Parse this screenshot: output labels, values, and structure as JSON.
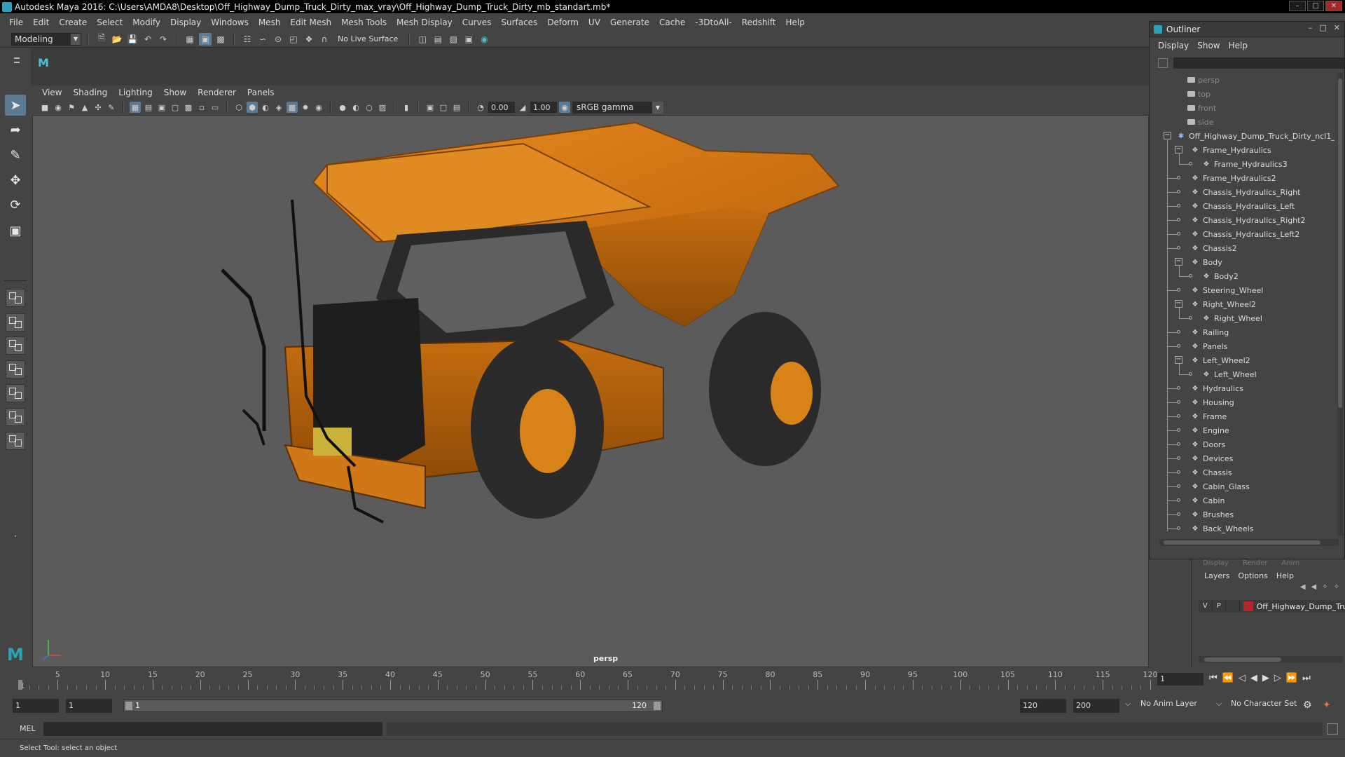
{
  "window": {
    "title": "Autodesk Maya 2016: C:\\Users\\AMDA8\\Desktop\\Off_Highway_Dump_Truck_Dirty_max_vray\\Off_Highway_Dump_Truck_Dirty_mb_standart.mb*"
  },
  "menubar": [
    "File",
    "Edit",
    "Create",
    "Select",
    "Modify",
    "Display",
    "Windows",
    "Mesh",
    "Edit Mesh",
    "Mesh Tools",
    "Mesh Display",
    "Curves",
    "Surfaces",
    "Deform",
    "UV",
    "Generate",
    "Cache",
    "-3DtoAll-",
    "Redshift",
    "Help"
  ],
  "statusline": {
    "mode": "Modeling",
    "live_surface": "No Live Surface"
  },
  "panel": {
    "menus": [
      "View",
      "Shading",
      "Lighting",
      "Show",
      "Renderer",
      "Panels"
    ],
    "exposure": "0.00",
    "gamma": "1.00",
    "color_space": "sRGB gamma",
    "camera": "persp"
  },
  "outliner": {
    "title": "Outliner",
    "menus": [
      "Display",
      "Show",
      "Help"
    ],
    "cameras": [
      "persp",
      "top",
      "front",
      "side"
    ],
    "root": "Off_Highway_Dump_Truck_Dirty_ncl1_",
    "items": [
      "Frame_Hydraulics",
      "Frame_Hydraulics3",
      "Frame_Hydraulics2",
      "Chassis_Hydraulics_Right",
      "Chassis_Hydraulics_Left",
      "Chassis_Hydraulics_Right2",
      "Chassis_Hydraulics_Left2",
      "Chassis2",
      "Body",
      "Body2",
      "Steering_Wheel",
      "Right_Wheel2",
      "Right_Wheel",
      "Railing",
      "Panels",
      "Left_Wheel2",
      "Left_Wheel",
      "Hydraulics",
      "Housing",
      "Frame",
      "Engine",
      "Doors",
      "Devices",
      "Chassis",
      "Cabin_Glass",
      "Cabin",
      "Brushes",
      "Back_Wheels"
    ]
  },
  "layers": {
    "tabs": [
      "Display",
      "Render",
      "Anim"
    ],
    "menus": [
      "Layers",
      "Options",
      "Help"
    ],
    "row": {
      "v": "V",
      "p": "P",
      "name": "Off_Highway_Dump_Truck_Dirty",
      "color": "#b3262e"
    }
  },
  "timeslider": {
    "labels": [
      "1",
      "5",
      "10",
      "15",
      "20",
      "25",
      "30",
      "35",
      "40",
      "45",
      "50",
      "55",
      "60",
      "65",
      "70",
      "75",
      "80",
      "85",
      "90",
      "95",
      "100",
      "105",
      "110",
      "115",
      "120"
    ],
    "current_frame": "1"
  },
  "range": {
    "start": "1",
    "playback_start": "1",
    "bar_start": "1",
    "bar_end": "120",
    "playback_end": "120",
    "end": "200",
    "anim_layer": "No Anim Layer",
    "character_set": "No Character Set"
  },
  "cmdline": {
    "lang": "MEL"
  },
  "helpline": {
    "text": "Select Tool: select an object"
  },
  "colors": {
    "accent": "#5d7a94",
    "truck": "#d97a14",
    "maya": "#2aa3b9"
  }
}
